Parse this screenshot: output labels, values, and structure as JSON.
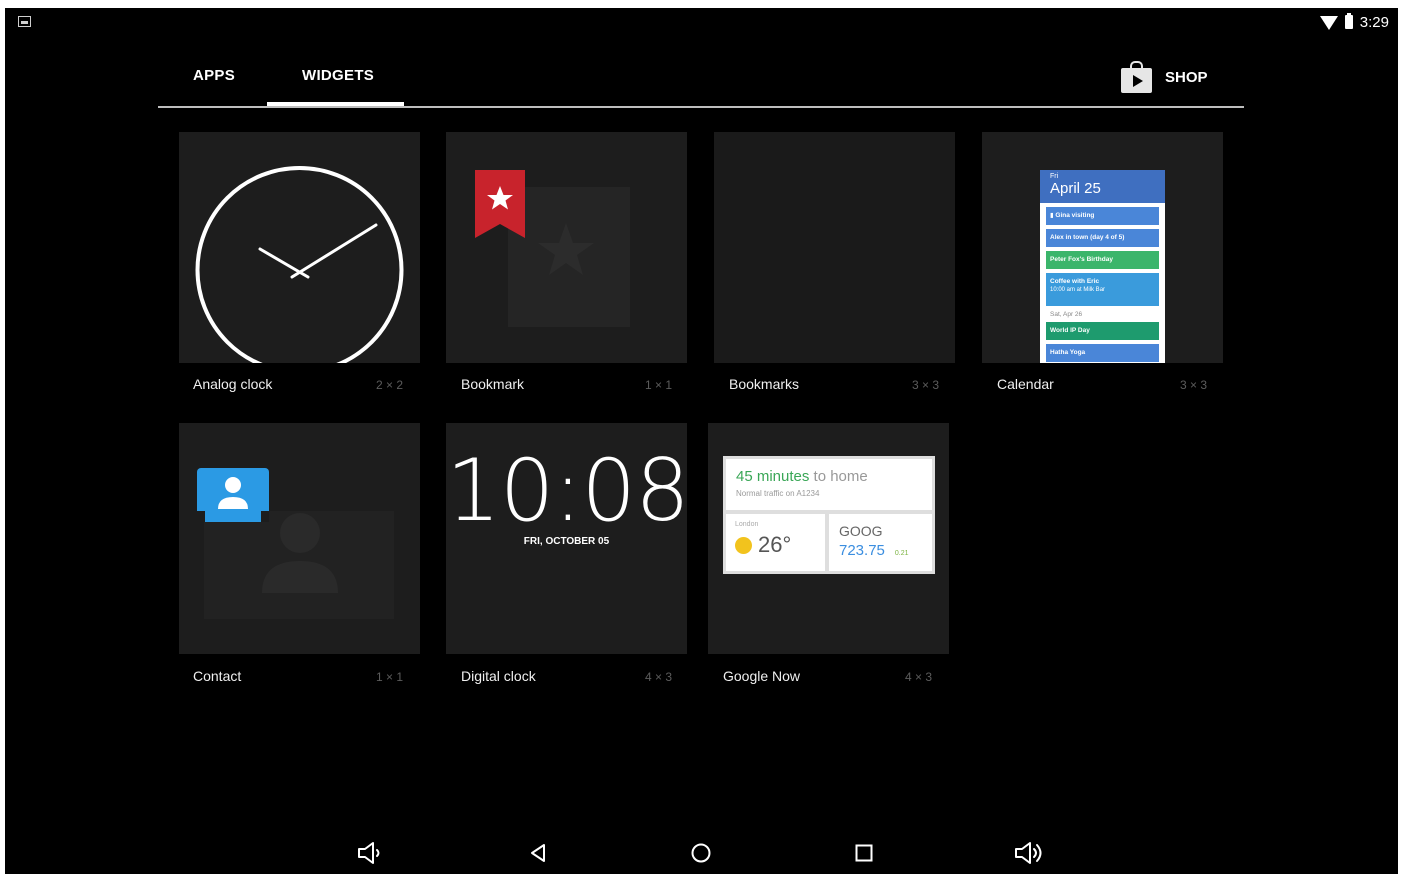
{
  "status_bar": {
    "time": "3:29",
    "icons": [
      "screenshot-icon",
      "wifi-icon",
      "battery-icon"
    ]
  },
  "tabs": [
    {
      "label": "APPS",
      "selected": false
    },
    {
      "label": "WIDGETS",
      "selected": true
    }
  ],
  "shop": {
    "label": "SHOP",
    "icon": "play-store-bag-icon"
  },
  "widgets": [
    {
      "name": "Analog clock",
      "size": "2 × 2"
    },
    {
      "name": "Bookmark",
      "size": "1 × 1"
    },
    {
      "name": "Bookmarks",
      "size": "3 × 3"
    },
    {
      "name": "Calendar",
      "size": "3 × 3"
    },
    {
      "name": "Contact",
      "size": "1 × 1"
    },
    {
      "name": "Digital clock",
      "size": "4 × 3"
    },
    {
      "name": "Google Now",
      "size": "4 × 3"
    }
  ],
  "calendar_preview": {
    "day": "Fri",
    "date": "April 25",
    "events": [
      {
        "text": "Gina visiting",
        "color": "#4a86d8"
      },
      {
        "text": "Alex in town (day 4 of 5)",
        "color": "#4a86d8"
      },
      {
        "text": "Peter Fox's Birthday",
        "color": "#3bb56b"
      },
      {
        "text": "Coffee with Eric",
        "sub": "10:00 am at Milk Bar",
        "color": "#3a9bdc"
      }
    ],
    "next_date": "Sat, Apr 26",
    "next_events": [
      {
        "text": "World IP Day",
        "color": "#1e9b6e"
      },
      {
        "text": "Hatha Yoga",
        "color": "#4a86d8"
      }
    ]
  },
  "digital_clock_preview": {
    "time": "10:08",
    "date": "FRI, OCTOBER 05"
  },
  "google_now_preview": {
    "commute_minutes": "45 minutes",
    "commute_rest": " to home",
    "traffic": "Normal traffic on A1234",
    "weather_city": "London",
    "weather_temp": "26°",
    "stock_ticker": "GOOG",
    "stock_price": "723.75",
    "stock_change": "0.21"
  },
  "nav_bar": [
    "volume-down-icon",
    "back-icon",
    "home-icon",
    "recents-icon",
    "volume-up-icon"
  ]
}
